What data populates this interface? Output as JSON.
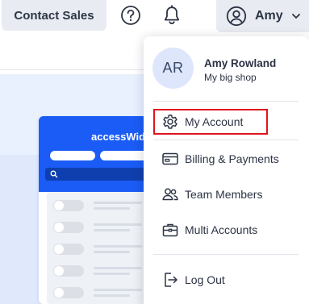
{
  "topbar": {
    "contact_label": "Contact Sales",
    "user_name": "Amy"
  },
  "widget": {
    "title": "accessWidg"
  },
  "profile": {
    "initials": "AR",
    "name": "Amy Rowland",
    "shop": "My big shop"
  },
  "menu": {
    "items": [
      {
        "label": "My Account",
        "icon": "gear-icon",
        "selected": true
      },
      {
        "label": "Billing & Payments",
        "icon": "credit-card-icon"
      },
      {
        "label": "Team Members",
        "icon": "team-icon"
      },
      {
        "label": "Multi Accounts",
        "icon": "briefcase-icon"
      }
    ],
    "logout_label": "Log Out"
  },
  "colors": {
    "accent": "#1a5cf5",
    "highlight": "#e0141e",
    "button_bg": "#e8ebf1"
  }
}
